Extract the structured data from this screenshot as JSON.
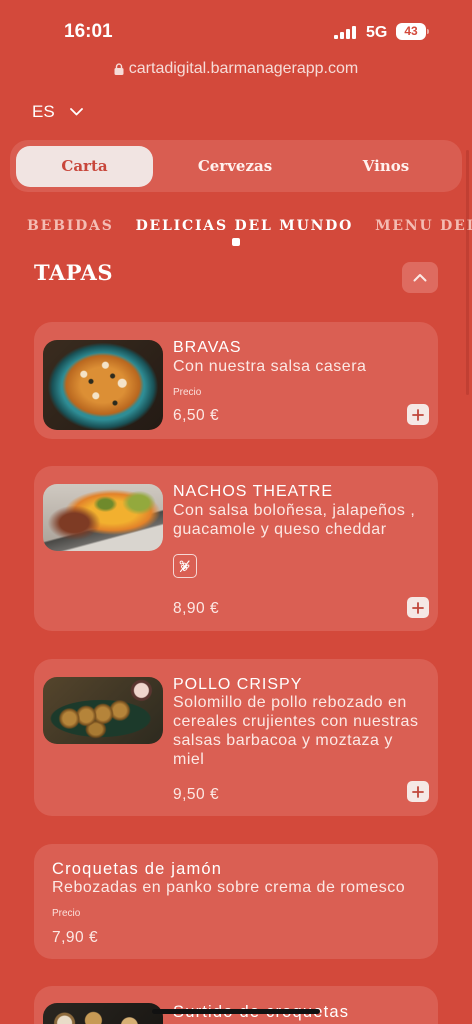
{
  "status_bar": {
    "time": "16:01",
    "network": "5G",
    "battery": "43"
  },
  "browser": {
    "url": "cartadigital.barmanagerapp.com"
  },
  "language_selector": {
    "value": "ES"
  },
  "tabs": [
    {
      "label": "Carta",
      "active": true
    },
    {
      "label": "Cervezas",
      "active": false
    },
    {
      "label": "Vinos",
      "active": false
    }
  ],
  "categories": [
    {
      "label": "BEBIDAS",
      "active": false
    },
    {
      "label": "DELICIAS DEL MUNDO",
      "active": true
    },
    {
      "label": "MENU DEL D",
      "active": false
    }
  ],
  "section": {
    "title": "TAPAS",
    "expanded": true
  },
  "items": [
    {
      "name": "BRAVAS",
      "description_lines": [
        "Con nuestra salsa casera"
      ],
      "price_label": "Precio",
      "price": "6,50 €"
    },
    {
      "name": "NACHOS THEATRE",
      "description_lines": [
        "Con salsa boloñesa, jalapeños ,",
        "guacamole y queso cheddar"
      ],
      "allergens": [
        "gluten-icon"
      ],
      "price": "8,90 €"
    },
    {
      "name": "POLLO CRISPY",
      "description_lines": [
        "Solomillo de pollo rebozado en",
        "cereales crujientes con nuestras",
        "salsas barbacoa y moztaza y",
        "miel"
      ],
      "price": "9,50 €"
    },
    {
      "name": "Croquetas de jamón",
      "description_lines": [
        "Rebozadas en panko sobre crema de romesco"
      ],
      "price_label": "Precio",
      "price": "7,90 €"
    },
    {
      "name": "Surtido de croquetas"
    }
  ],
  "icons": {
    "lock": "lock-icon",
    "language": "chevron-down-icon",
    "collapse": "chevron-up-icon",
    "add": "plus-icon",
    "signal": "cellular-signal-icon",
    "battery": "battery-icon"
  },
  "colors": {
    "background": "#D3493B",
    "panel": "#D95D51",
    "card": "#DA5F53",
    "active_tab": "#F1E4E2",
    "active_tab_text": "#C8463B",
    "category_inactive": "#F4BCB3",
    "button": "#F5E8E5",
    "button_icon": "#C0453A"
  }
}
